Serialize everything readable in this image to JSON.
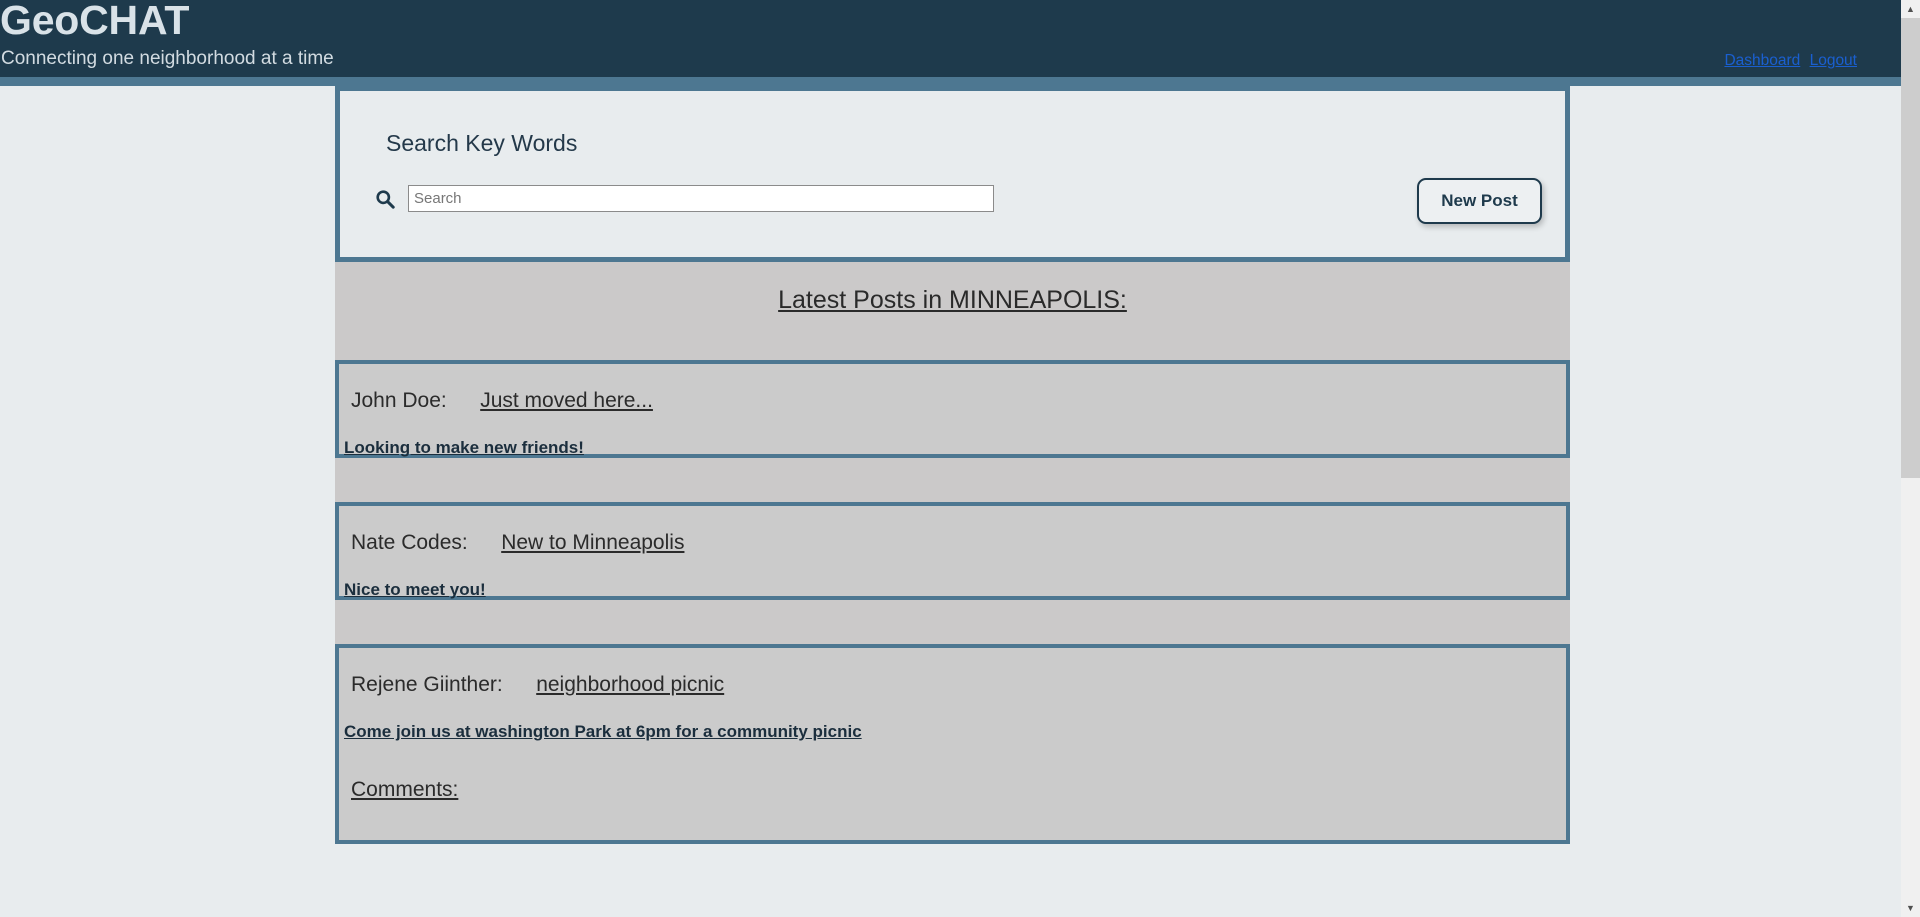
{
  "header": {
    "brand": "GeoCHAT",
    "tagline": "Connecting one neighborhood at a time",
    "nav": {
      "dashboard": "Dashboard",
      "logout": "Logout"
    },
    "colors": {
      "navbar_bg": "#1e3a4c",
      "accent_border": "#4d7791",
      "link": "#1a5fd0"
    }
  },
  "search": {
    "heading": "Search Key Words",
    "placeholder": "Search",
    "value": "",
    "icon": "search-icon",
    "new_post_label": "New Post"
  },
  "feed": {
    "banner": "Latest Posts in MINNEAPOLIS:",
    "posts": [
      {
        "author": "John Doe:",
        "title": "Just moved here...",
        "body": "Looking to make new friends!",
        "comments_label": ""
      },
      {
        "author": "Nate Codes:",
        "title": "New to Minneapolis",
        "body": "Nice to meet you!",
        "comments_label": ""
      },
      {
        "author": "Rejene Giinther:",
        "title": "neighborhood picnic",
        "body": "Come join us at washington Park at 6pm for a community picnic",
        "comments_label": "Comments:"
      }
    ]
  },
  "scrollbar": {
    "up_arrow": "▲",
    "down_arrow": "▼"
  }
}
